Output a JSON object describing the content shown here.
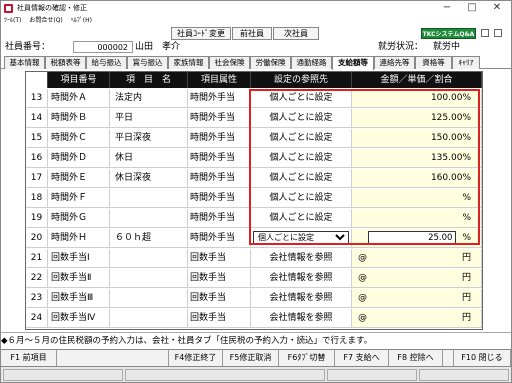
{
  "window": {
    "title": "社員情報の確認・修正",
    "min": "−",
    "max": "□",
    "close": "✕"
  },
  "menu": [
    "ﾂｰﾙ(T)",
    "お問合せ(Q)",
    "ﾍﾙﾌﾟ(H)"
  ],
  "toolbar": {
    "code_change": "社員ｺｰﾄﾞ変更",
    "prev_emp": "前社員",
    "next_emp": "次社員",
    "logo": "TKCシステムQ&A"
  },
  "employee": {
    "no_label": "社員番号：",
    "no": "000002",
    "name": "山田　孝介",
    "status_label": "就労状況：",
    "status": "就労中"
  },
  "tabs": [
    "基本情報",
    "税額表等",
    "給与振込",
    "賞与振込",
    "家族情報",
    "社会保険",
    "労働保険",
    "通勤経路",
    "支給額等",
    "連絡先等",
    "資格等",
    "ｷｬﾘｱ"
  ],
  "active_tab": "支給額等",
  "table": {
    "headers": [
      "行",
      "項目番号",
      "項　目　名",
      "項目属性",
      "設定の参照先",
      "金額／単価／割合"
    ],
    "rows": [
      {
        "no": "13",
        "code": "時間外Ａ",
        "name": "法定内",
        "attr": "時間外手当",
        "ref": "個人ごとに設定",
        "amount": "100.00%",
        "unit": ""
      },
      {
        "no": "14",
        "code": "時間外Ｂ",
        "name": "平日",
        "attr": "時間外手当",
        "ref": "個人ごとに設定",
        "amount": "125.00%",
        "unit": ""
      },
      {
        "no": "15",
        "code": "時間外Ｃ",
        "name": "平日深夜",
        "attr": "時間外手当",
        "ref": "個人ごとに設定",
        "amount": "150.00%",
        "unit": ""
      },
      {
        "no": "16",
        "code": "時間外Ｄ",
        "name": "休日",
        "attr": "時間外手当",
        "ref": "個人ごとに設定",
        "amount": "135.00%",
        "unit": ""
      },
      {
        "no": "17",
        "code": "時間外Ｅ",
        "name": "休日深夜",
        "attr": "時間外手当",
        "ref": "個人ごとに設定",
        "amount": "160.00%",
        "unit": ""
      },
      {
        "no": "18",
        "code": "時間外Ｆ",
        "name": "",
        "attr": "時間外手当",
        "ref": "個人ごとに設定",
        "amount": "",
        "unit": "%"
      },
      {
        "no": "19",
        "code": "時間外Ｇ",
        "name": "",
        "attr": "時間外手当",
        "ref": "個人ごとに設定",
        "amount": "",
        "unit": "%"
      },
      {
        "no": "20",
        "code": "時間外Ｈ",
        "name": "６０ｈ超",
        "attr": "時間外手当",
        "ref": "個人ごとに設定",
        "amount": "25.00",
        "unit": "%"
      },
      {
        "no": "21",
        "code": "回数手当Ⅰ",
        "name": "",
        "attr": "回数手当",
        "ref": "会社情報を参照",
        "amount": "@",
        "unit": "円"
      },
      {
        "no": "22",
        "code": "回数手当Ⅱ",
        "name": "",
        "attr": "回数手当",
        "ref": "会社情報を参照",
        "amount": "@",
        "unit": "円"
      },
      {
        "no": "23",
        "code": "回数手当Ⅲ",
        "name": "",
        "attr": "回数手当",
        "ref": "会社情報を参照",
        "amount": "@",
        "unit": "円"
      },
      {
        "no": "24",
        "code": "回数手当Ⅳ",
        "name": "",
        "attr": "回数手当",
        "ref": "会社情報を参照",
        "amount": "@",
        "unit": "円"
      }
    ],
    "editing": {
      "row": 7,
      "select_value": "個人ごとに設定",
      "select_options": [
        "個人ごとに設定",
        "会社情報を参照"
      ],
      "amount_value": "25.00",
      "unit": "%"
    }
  },
  "note": "◆６月～５月の住民税額の予約入力は、会社・社員タブ「住民税の予約入力・読込」で行えます。",
  "fkeys": [
    "F1 前項目",
    "F4修正終了",
    "F5修正取消",
    "F6ﾀﾌﾞ切替",
    "F7 支給へ",
    "F8 控除へ",
    "F10 閉じる"
  ],
  "colors": {
    "accent": "#e02020",
    "header_bg": "#111111",
    "edit_cell": "#ffffe0",
    "logo_bg": "#1f8a3a"
  }
}
